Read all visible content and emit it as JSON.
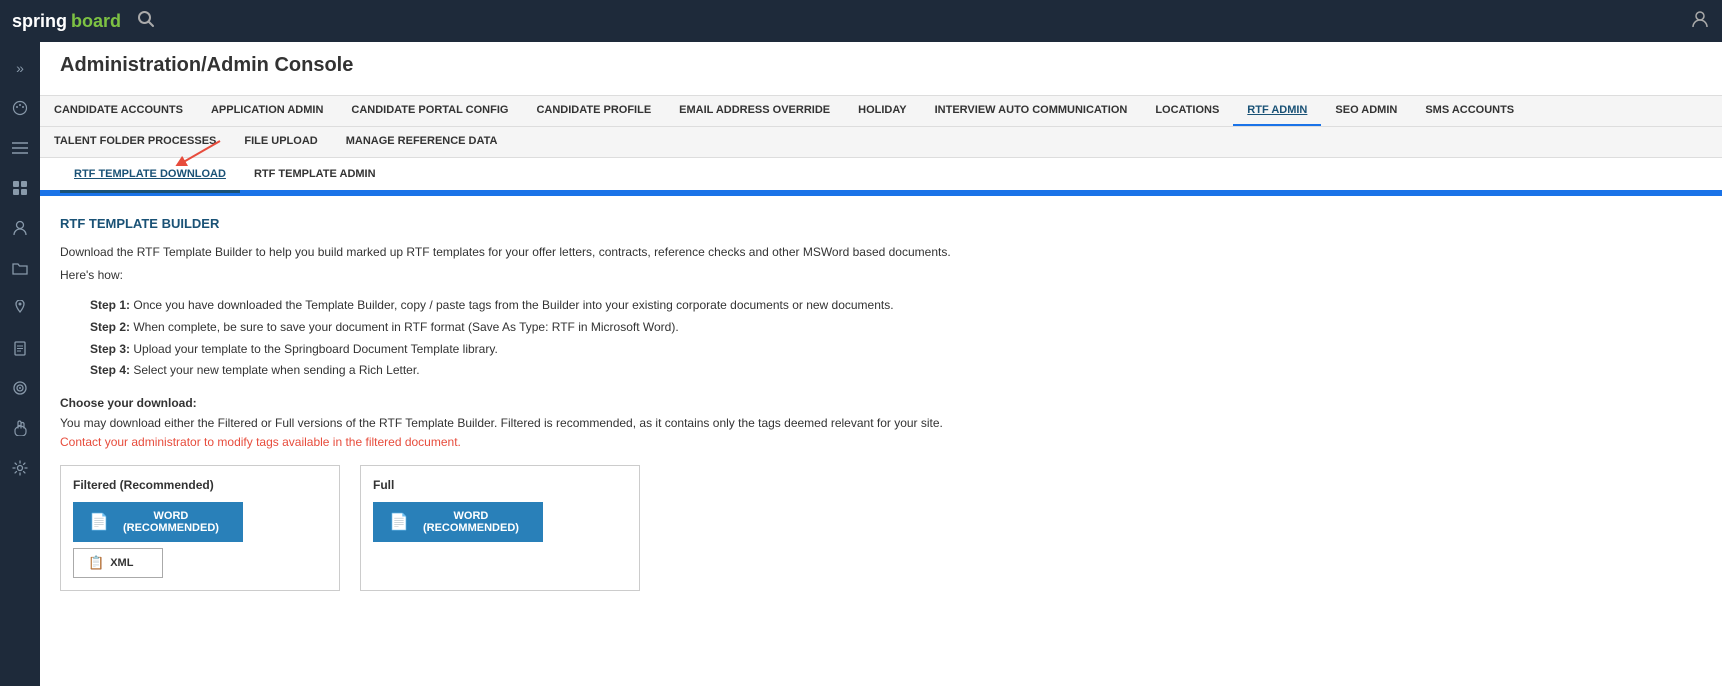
{
  "topbar": {
    "logo_spring": "spring",
    "logo_board": "board",
    "search_icon": "🔍",
    "user_icon": "👤"
  },
  "sidebar": {
    "icons": [
      {
        "name": "chevron-right",
        "glyph": "»"
      },
      {
        "name": "palette",
        "glyph": "🎨"
      },
      {
        "name": "list",
        "glyph": "☰"
      },
      {
        "name": "grid",
        "glyph": "⊞"
      },
      {
        "name": "person",
        "glyph": "👤"
      },
      {
        "name": "folder",
        "glyph": "📁"
      },
      {
        "name": "pin",
        "glyph": "📌"
      },
      {
        "name": "document",
        "glyph": "📄"
      },
      {
        "name": "target",
        "glyph": "◎"
      },
      {
        "name": "hand",
        "glyph": "✋"
      },
      {
        "name": "gear",
        "glyph": "⚙"
      }
    ]
  },
  "page": {
    "title": "Administration/Admin Console"
  },
  "primary_nav": {
    "items": [
      {
        "id": "candidate-accounts",
        "label": "CANDIDATE ACCOUNTS",
        "active": false
      },
      {
        "id": "application-admin",
        "label": "APPLICATION ADMIN",
        "active": false
      },
      {
        "id": "candidate-portal-config",
        "label": "CANDIDATE PORTAL CONFIG",
        "active": false
      },
      {
        "id": "candidate-profile",
        "label": "CANDIDATE PROFILE",
        "active": false
      },
      {
        "id": "email-address-override",
        "label": "EMAIL ADDRESS OVERRIDE",
        "active": false
      },
      {
        "id": "holiday",
        "label": "HOLIDAY",
        "active": false
      },
      {
        "id": "interview-auto-communication",
        "label": "INTERVIEW AUTO COMMUNICATION",
        "active": false
      },
      {
        "id": "locations",
        "label": "LOCATIONS",
        "active": false
      },
      {
        "id": "rtf-admin",
        "label": "RTF ADMIN",
        "active": true
      },
      {
        "id": "seo-admin",
        "label": "SEO ADMIN",
        "active": false
      },
      {
        "id": "sms-accounts",
        "label": "SMS ACCOUNTS",
        "active": false
      }
    ]
  },
  "secondary_nav": {
    "items": [
      {
        "id": "talent-folder-processes",
        "label": "TALENT FOLDER PROCESSES"
      },
      {
        "id": "file-upload",
        "label": "FILE UPLOAD"
      },
      {
        "id": "manage-reference-data",
        "label": "MANAGE REFERENCE DATA"
      }
    ]
  },
  "sub_tabs": {
    "items": [
      {
        "id": "rtf-template-download",
        "label": "RTF TEMPLATE DOWNLOAD",
        "active": true
      },
      {
        "id": "rtf-template-admin",
        "label": "RTF TEMPLATE ADMIN",
        "active": false
      }
    ]
  },
  "content": {
    "section_title": "RTF TEMPLATE BUILDER",
    "description_line1": "Download the RTF Template Builder to help you build marked up RTF templates for your offer letters, contracts, reference checks and other MSWord based documents.",
    "description_line2": "Here's how:",
    "steps": [
      {
        "label": "Step 1:",
        "text": "Once you have downloaded the Template Builder, copy / paste tags from the Builder into your existing corporate documents or new documents."
      },
      {
        "label": "Step 2:",
        "text": "When complete, be sure to save your document in RTF format (Save As Type: RTF in Microsoft Word)."
      },
      {
        "label": "Step 3:",
        "text": "Upload your template to the Springboard Document Template library."
      },
      {
        "label": "Step 4:",
        "text": "Select your new template when sending a Rich Letter."
      }
    ],
    "choose_title": "Choose your download:",
    "choose_desc": "You may download either the Filtered or Full versions of the RTF Template Builder. Filtered is recommended, as it contains only the tags deemed relevant for your site.",
    "choose_link": "Contact your administrator to modify tags available in the filtered document.",
    "filtered_title": "Filtered (Recommended)",
    "full_title": "Full",
    "word_btn_label": "WORD (RECOMMENDED)",
    "xml_btn_label": "XML"
  }
}
